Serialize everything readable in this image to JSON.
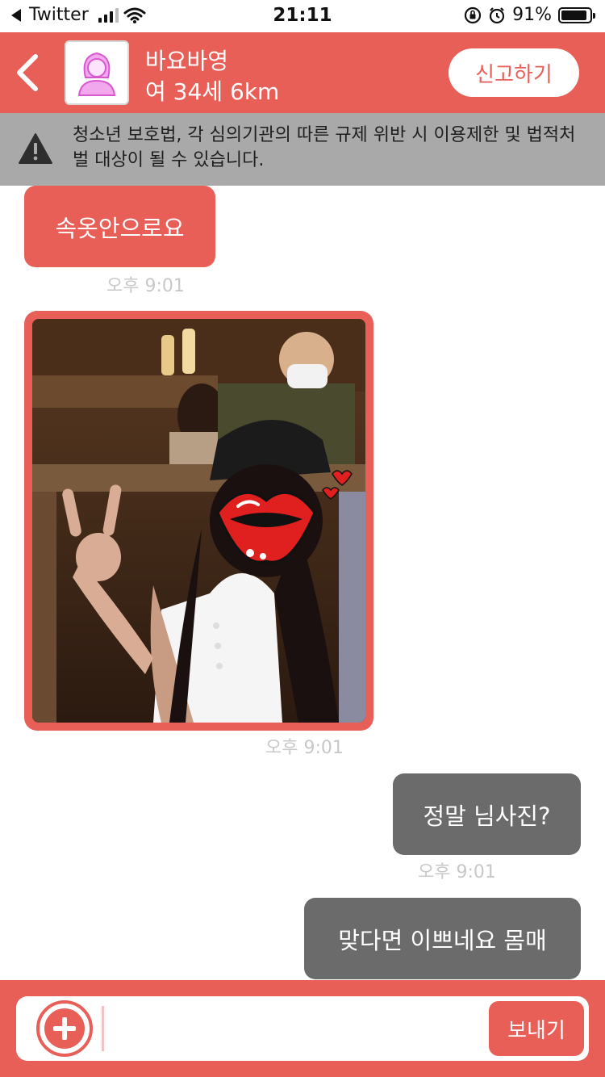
{
  "status_bar": {
    "back_app": "Twitter",
    "time": "21:11",
    "battery_percent": "91%",
    "battery_level": 0.91,
    "icons": [
      "back-arrow-icon",
      "signal-icon",
      "wifi-icon",
      "rotation-lock-icon",
      "alarm-icon",
      "battery-icon"
    ]
  },
  "header": {
    "name": "바요바영",
    "meta": "여 34세 6km",
    "report_label": "신고하기",
    "icons": [
      "chevron-left-icon",
      "profile-avatar-icon"
    ]
  },
  "warning": {
    "text": "청소년 보호법, 각 심의기관의 따른 규제 위반 시 이용제한 및 법적처벌 대상이 될 수 있습니다.",
    "icon": "warning-icon"
  },
  "messages": [
    {
      "direction": "incoming",
      "type": "text",
      "text": "속옷안으로요",
      "time": "오후 9:01"
    },
    {
      "direction": "incoming",
      "type": "image",
      "time": "오후 9:01"
    },
    {
      "direction": "outgoing",
      "type": "text",
      "text": "정말 님사진?",
      "time": "오후 9:01"
    },
    {
      "direction": "outgoing",
      "type": "text",
      "text": "맞다면 이쁘네요 몸매"
    }
  ],
  "input": {
    "value": "",
    "send_label": "보내기",
    "icon": "plus-circle-icon"
  },
  "colors": {
    "accent": "#e85f58",
    "incoming_bubble": "#e85f58",
    "outgoing_bubble": "#6b6b6b",
    "warning_bg": "#a9a9a9",
    "timestamp": "#c8c8c8"
  }
}
